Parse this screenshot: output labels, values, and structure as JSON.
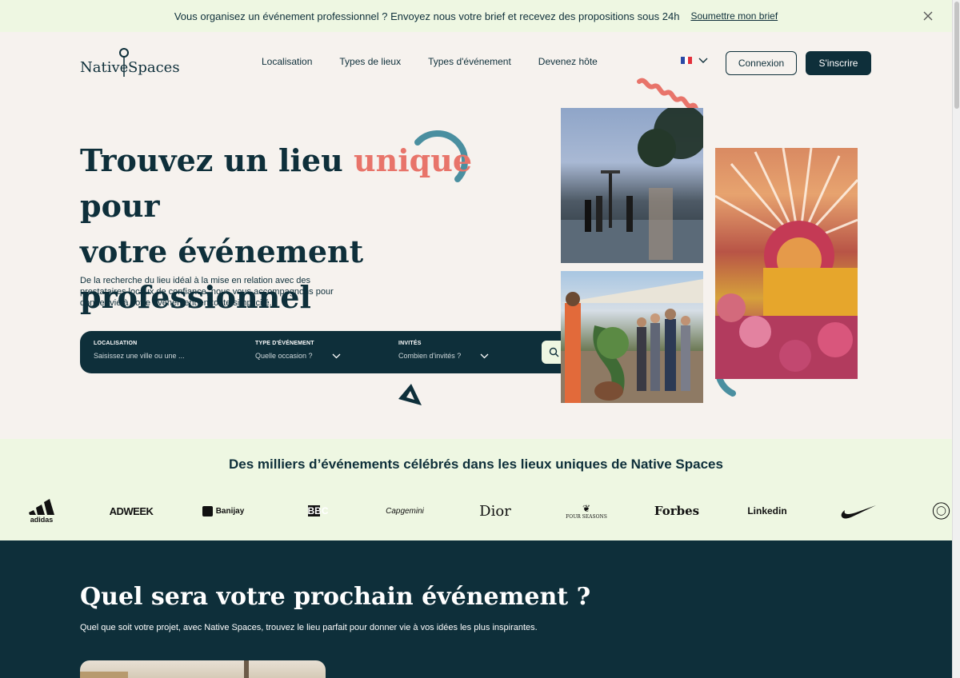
{
  "banner": {
    "message": "Vous organisez un événement professionnel ? Envoyez nous votre brief et recevez des propositions sous 24h",
    "link": "Soumettre mon brief"
  },
  "logo": {
    "word1": "Native",
    "word2": "Spaces"
  },
  "nav": {
    "items": [
      "Localisation",
      "Types de lieux",
      "Types d'événement",
      "Devenez hôte"
    ],
    "login": "Connexion",
    "signup": "S'inscrire"
  },
  "hero": {
    "title_line1_a": "Trouvez un lieu ",
    "title_accent": "unique",
    "title_line1_b": " pour",
    "title_line2": "votre événement",
    "title_line3": "professionnel",
    "subtitle": "De la recherche du lieu idéal à la mise en relation avec des prestataires locaux de confiance, nous vous accompagnons pour donner vie à votre événement en toute simplicité."
  },
  "search": {
    "location_label": "LOCALISATION",
    "location_placeholder": "Saisissez une ville ou une ...",
    "event_label": "TYPE D'ÉVÉNEMENT",
    "event_value": "Quelle occasion ?",
    "guests_label": "INVITÉS",
    "guests_value": "Combien d'invités ?"
  },
  "brands": {
    "title": "Des milliers d’événements célébrés dans les lieux uniques de Native Spaces",
    "logos": [
      "adidas",
      "ADWEEK",
      "Banijay",
      "BBC",
      "Capgemini",
      "Dior",
      "FOUR SEASONS",
      "Forbes",
      "Linkedin",
      "NIKE"
    ]
  },
  "next": {
    "title": "Quel sera votre prochain événement ?",
    "subtitle": "Quel que soit votre projet, avec Native Spaces, trouvez le lieu parfait pour donner vie à vos idées les plus inspirantes."
  },
  "colors": {
    "navy": "#0e2f3a",
    "accent": "#e8746a",
    "mint": "#eef7e2",
    "teal": "#4a8fa0"
  }
}
